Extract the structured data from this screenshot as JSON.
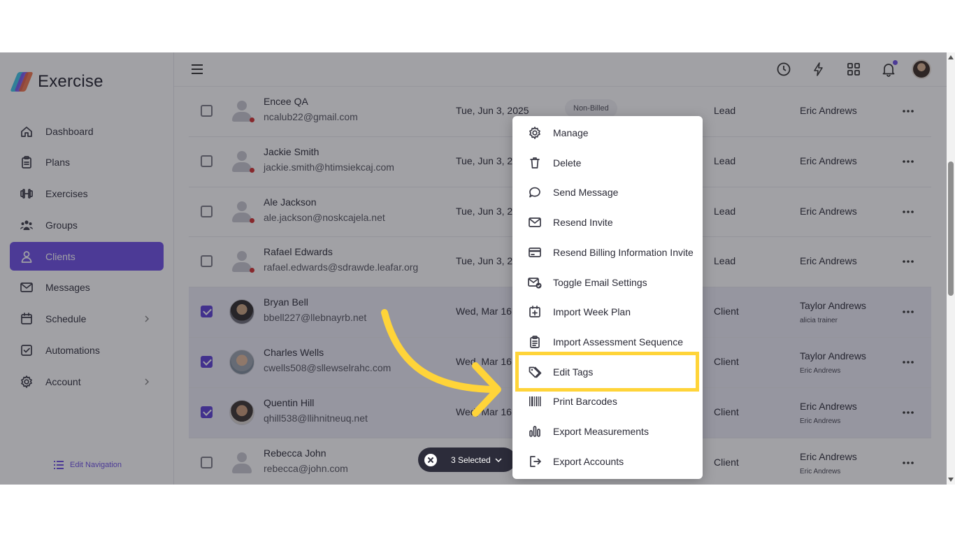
{
  "app": {
    "name": "Exercise"
  },
  "sidebar": {
    "items": [
      {
        "label": "Dashboard",
        "icon": "home-icon",
        "active": false,
        "chevron": false
      },
      {
        "label": "Plans",
        "icon": "clipboard-icon",
        "active": false,
        "chevron": false
      },
      {
        "label": "Exercises",
        "icon": "dumbbell-icon",
        "active": false,
        "chevron": false
      },
      {
        "label": "Groups",
        "icon": "group-icon",
        "active": false,
        "chevron": false
      },
      {
        "label": "Clients",
        "icon": "user-icon",
        "active": true,
        "chevron": false
      },
      {
        "label": "Messages",
        "icon": "mail-icon",
        "active": false,
        "chevron": false
      },
      {
        "label": "Schedule",
        "icon": "calendar-icon",
        "active": false,
        "chevron": true
      },
      {
        "label": "Automations",
        "icon": "checkbox-icon",
        "active": false,
        "chevron": false
      },
      {
        "label": "Account",
        "icon": "gear-icon",
        "active": false,
        "chevron": true
      }
    ],
    "edit_navigation": "Edit Navigation"
  },
  "topbar": {
    "icons": [
      "clock-icon",
      "lightning-icon",
      "apps-grid-icon",
      "bell-icon"
    ]
  },
  "clients": [
    {
      "name": "Encee QA",
      "email": "ncalub22@gmail.com",
      "date": "Tue, Jun 3, 2025",
      "badge": "Non-Billed",
      "type": "Lead",
      "trainer": "Eric Andrews",
      "sub": "",
      "checked": false,
      "avatar": "placeholder"
    },
    {
      "name": "Jackie Smith",
      "email": "jackie.smith@htimsiekcaj.com",
      "date": "Tue, Jun 3, 20",
      "badge": "",
      "type": "Lead",
      "trainer": "Eric Andrews",
      "sub": "",
      "checked": false,
      "avatar": "placeholder"
    },
    {
      "name": "Ale Jackson",
      "email": "ale.jackson@noskcajela.net",
      "date": "Tue, Jun 3, 20",
      "badge": "",
      "type": "Lead",
      "trainer": "Eric Andrews",
      "sub": "",
      "checked": false,
      "avatar": "placeholder"
    },
    {
      "name": "Rafael Edwards",
      "email": "rafael.edwards@sdrawde.leafar.org",
      "date": "Tue, Jun 3, 20",
      "badge": "",
      "type": "Lead",
      "trainer": "Eric Andrews",
      "sub": "",
      "checked": false,
      "avatar": "placeholder"
    },
    {
      "name": "Bryan Bell",
      "email": "bbell227@llebnayrb.net",
      "date": "Wed, Mar 16,",
      "badge": "",
      "type": "Client",
      "trainer": "Taylor Andrews",
      "sub": "alicia trainer",
      "checked": true,
      "avatar": "photo1"
    },
    {
      "name": "Charles Wells",
      "email": "cwells508@sllewselrahc.com",
      "date": "Wed, Mar 16,",
      "badge": "",
      "type": "Client",
      "trainer": "Taylor Andrews",
      "sub": "Eric Andrews",
      "checked": true,
      "avatar": "photo2"
    },
    {
      "name": "Quentin Hill",
      "email": "qhill538@llihnitneuq.net",
      "date": "Wed, Mar 16,",
      "badge": "",
      "type": "Client",
      "trainer": "Eric Andrews",
      "sub": "Eric Andrews",
      "checked": true,
      "avatar": "photo3"
    },
    {
      "name": "Rebecca John",
      "email": "rebecca@john.com",
      "date": "",
      "badge": "",
      "type": "Client",
      "trainer": "Eric Andrews",
      "sub": "Eric Andrews",
      "checked": false,
      "avatar": "placeholder-nodot"
    }
  ],
  "selection": {
    "label": "3 Selected"
  },
  "menu": {
    "items": [
      {
        "label": "Manage",
        "icon": "gear-icon"
      },
      {
        "label": "Delete",
        "icon": "trash-icon"
      },
      {
        "label": "Send Message",
        "icon": "chat-bubble-icon"
      },
      {
        "label": "Resend Invite",
        "icon": "envelope-icon"
      },
      {
        "label": "Resend Billing Information Invite",
        "icon": "credit-card-icon"
      },
      {
        "label": "Toggle Email Settings",
        "icon": "email-check-icon"
      },
      {
        "label": "Import Week Plan",
        "icon": "calendar-plus-icon"
      },
      {
        "label": "Import Assessment Sequence",
        "icon": "clipboard-list-icon"
      },
      {
        "label": "Edit Tags",
        "icon": "tags-icon"
      },
      {
        "label": "Print Barcodes",
        "icon": "barcode-icon"
      },
      {
        "label": "Export Measurements",
        "icon": "bar-chart-icon"
      },
      {
        "label": "Export Accounts",
        "icon": "export-icon"
      }
    ],
    "highlighted": "Edit Tags"
  },
  "colors": {
    "accent": "#6d4fe6",
    "highlight": "#ffd439",
    "status_dot": "#d32f2f"
  }
}
